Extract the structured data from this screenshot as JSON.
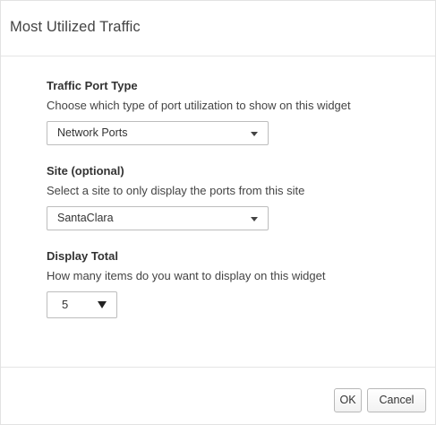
{
  "dialog": {
    "title": "Most Utilized Traffic"
  },
  "port_type": {
    "label": "Traffic Port Type",
    "help": "Choose which type of port utilization to show on this widget",
    "selected": "Network Ports"
  },
  "site": {
    "label": "Site (optional)",
    "help": "Select a site to only display the ports from this site",
    "selected": "SantaClara"
  },
  "display_total": {
    "label": "Display Total",
    "help": "How many items do you want to display on this widget",
    "selected": "5"
  },
  "footer": {
    "ok_label": "OK",
    "cancel_label": "Cancel"
  }
}
